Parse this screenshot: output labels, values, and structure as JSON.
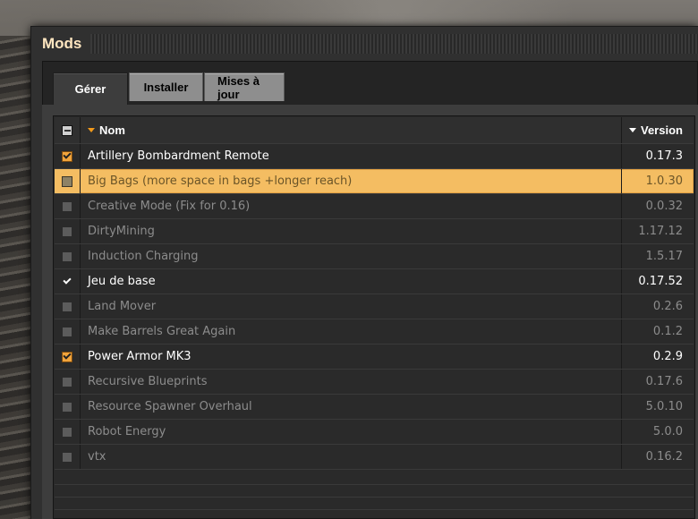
{
  "window": {
    "title": "Mods"
  },
  "tabs": [
    {
      "label": "Gérer",
      "active": true
    },
    {
      "label": "Installer",
      "active": false
    },
    {
      "label": "Mises à jour",
      "active": false
    }
  ],
  "table": {
    "columns": {
      "name": "Nom",
      "version": "Version"
    },
    "rows": [
      {
        "name": "Artillery Bombardment Remote",
        "version": "0.17.3",
        "enabled": true,
        "selected": false,
        "check_style": "orange"
      },
      {
        "name": "Big Bags (more space in bags +longer reach)",
        "version": "1.0.30",
        "enabled": false,
        "selected": true,
        "check_style": "none"
      },
      {
        "name": "Creative Mode (Fix for 0.16)",
        "version": "0.0.32",
        "enabled": false,
        "selected": false,
        "check_style": "none"
      },
      {
        "name": "DirtyMining",
        "version": "1.17.12",
        "enabled": false,
        "selected": false,
        "check_style": "none"
      },
      {
        "name": "Induction Charging",
        "version": "1.5.17",
        "enabled": false,
        "selected": false,
        "check_style": "none"
      },
      {
        "name": "Jeu de base",
        "version": "0.17.52",
        "enabled": true,
        "selected": false,
        "check_style": "white"
      },
      {
        "name": "Land Mover",
        "version": "0.2.6",
        "enabled": false,
        "selected": false,
        "check_style": "none"
      },
      {
        "name": "Make Barrels Great Again",
        "version": "0.1.2",
        "enabled": false,
        "selected": false,
        "check_style": "none"
      },
      {
        "name": "Power Armor MK3",
        "version": "0.2.9",
        "enabled": true,
        "selected": false,
        "check_style": "orange"
      },
      {
        "name": "Recursive Blueprints",
        "version": "0.17.6",
        "enabled": false,
        "selected": false,
        "check_style": "none"
      },
      {
        "name": "Resource Spawner Overhaul",
        "version": "5.0.10",
        "enabled": false,
        "selected": false,
        "check_style": "none"
      },
      {
        "name": "Robot Energy",
        "version": "5.0.0",
        "enabled": false,
        "selected": false,
        "check_style": "none"
      },
      {
        "name": "vtx",
        "version": "0.16.2",
        "enabled": false,
        "selected": false,
        "check_style": "none"
      }
    ]
  },
  "colors": {
    "accent_orange": "#f29a1b",
    "selected_row": "#f4bd62",
    "title_text": "#ffe6c0"
  }
}
